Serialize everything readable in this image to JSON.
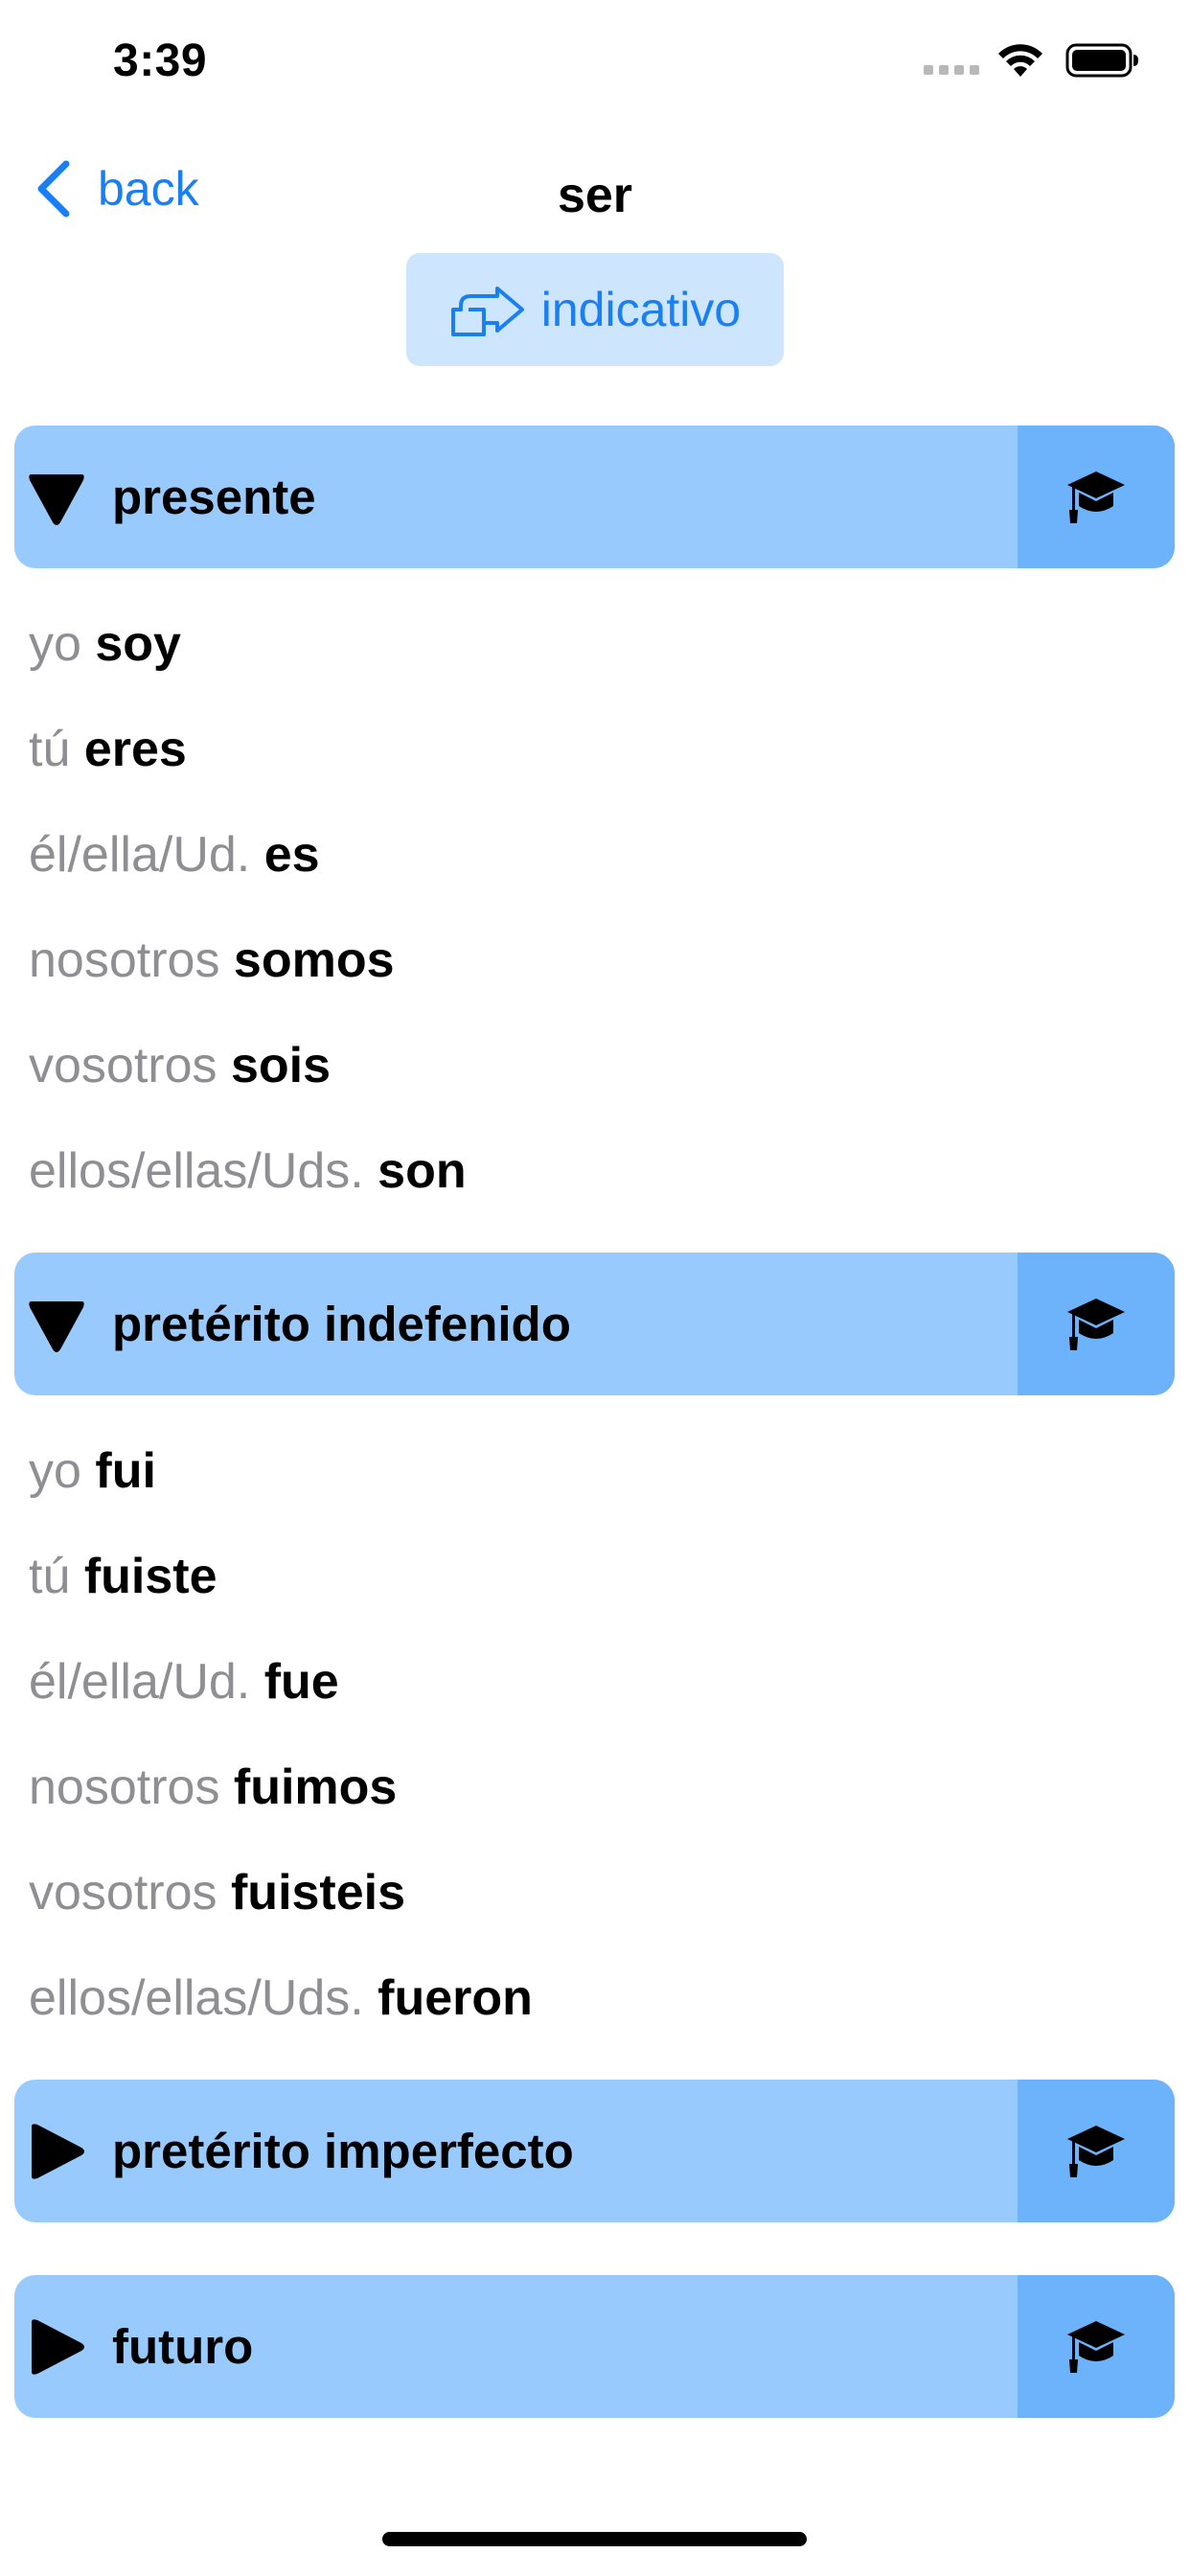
{
  "status_bar": {
    "time": "3:39"
  },
  "nav": {
    "back_label": "back",
    "title": "ser"
  },
  "mood": {
    "label": "indicativo"
  },
  "tenses": [
    {
      "label": "presente",
      "expanded": true,
      "rows": [
        {
          "pronoun": "yo",
          "form": "soy"
        },
        {
          "pronoun": "tú",
          "form": "eres"
        },
        {
          "pronoun": "él/ella/Ud.",
          "form": "es"
        },
        {
          "pronoun": "nosotros",
          "form": "somos"
        },
        {
          "pronoun": "vosotros",
          "form": "sois"
        },
        {
          "pronoun": "ellos/ellas/Uds.",
          "form": "son"
        }
      ]
    },
    {
      "label": "pretérito indefenido",
      "expanded": true,
      "rows": [
        {
          "pronoun": "yo",
          "form": "fui"
        },
        {
          "pronoun": "tú",
          "form": "fuiste"
        },
        {
          "pronoun": "él/ella/Ud.",
          "form": "fue"
        },
        {
          "pronoun": "nosotros",
          "form": "fuimos"
        },
        {
          "pronoun": "vosotros",
          "form": "fuisteis"
        },
        {
          "pronoun": "ellos/ellas/Uds.",
          "form": "fueron"
        }
      ]
    },
    {
      "label": "pretérito imperfecto",
      "expanded": false,
      "rows": []
    },
    {
      "label": "futuro",
      "expanded": false,
      "rows": []
    }
  ],
  "icons": {
    "back": "chevron-left-icon",
    "mood": "arrow-right-outline-icon",
    "expanded": "triangle-down-icon",
    "collapsed": "triangle-right-icon",
    "quiz": "graduation-cap-icon"
  },
  "colors": {
    "accent": "#1a7ff2",
    "header_bg": "#99cafd",
    "quiz_bg": "#6cb3fb",
    "mood_bg": "#cde5fd",
    "pronoun": "#8e8e93"
  }
}
